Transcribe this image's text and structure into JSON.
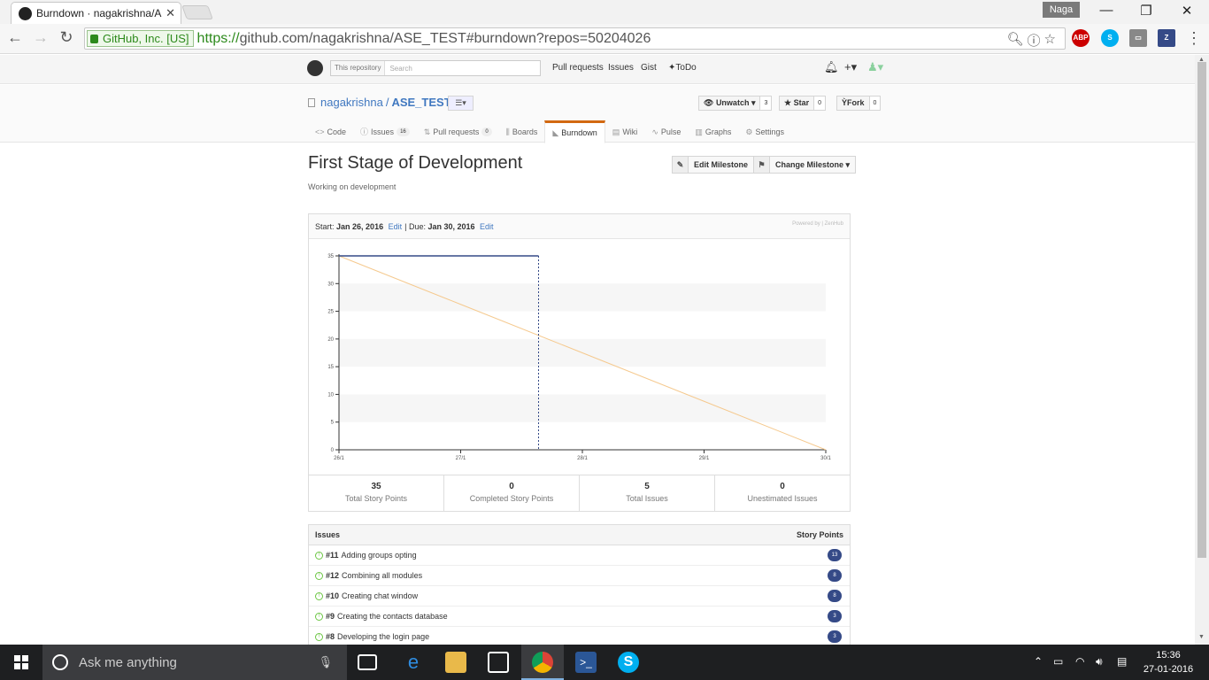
{
  "browser": {
    "tab_title": "Burndown · nagakrishna/A",
    "profile": "Naga",
    "ev_cert": "GitHub, Inc. [US]",
    "url_scheme": "https://",
    "url_rest": "github.com/nagakrishna/ASE_TEST#burndown?repos=50204026"
  },
  "github_header": {
    "search_scope": "This repository",
    "search_placeholder": "Search",
    "nav": [
      "Pull requests",
      "Issues",
      "Gist",
      "ToDo"
    ]
  },
  "repo": {
    "owner": "nagakrishna",
    "name": "ASE_TEST",
    "unwatch_label": "Unwatch",
    "unwatch_count": "3",
    "star_label": "Star",
    "star_count": "0",
    "fork_label": "Fork",
    "fork_count": "0",
    "tabs": [
      {
        "label": "Code",
        "icon": "<>"
      },
      {
        "label": "Issues",
        "counter": "16"
      },
      {
        "label": "Pull requests",
        "counter": "0"
      },
      {
        "label": "Boards"
      },
      {
        "label": "Burndown"
      },
      {
        "label": "Wiki"
      },
      {
        "label": "Pulse"
      },
      {
        "label": "Graphs"
      },
      {
        "label": "Settings"
      }
    ]
  },
  "milestone": {
    "title": "First Stage of Development",
    "description": "Working on development",
    "edit_label": "Edit Milestone",
    "change_label": "Change Milestone",
    "start_label": "Start:",
    "start_date": "Jan 26, 2016",
    "due_label": "Due:",
    "due_date": "Jan 30, 2016",
    "edit_link": "Edit",
    "powered_by": "Powered by | ZenHub"
  },
  "chart_data": {
    "type": "line",
    "x": [
      "26/1",
      "27/1",
      "28/1",
      "29/1",
      "30/1"
    ],
    "yticks": [
      0,
      5,
      10,
      15,
      20,
      25,
      30,
      35
    ],
    "ylim": [
      0,
      35
    ],
    "series": [
      {
        "values": [
          35,
          35,
          35
        ],
        "color": "#354a87"
      },
      {
        "values": [
          35,
          26.25,
          17.5,
          8.75,
          0
        ],
        "color": "#f5c98e"
      }
    ],
    "grid": true
  },
  "stats": [
    {
      "value": "35",
      "label": "Total Story Points"
    },
    {
      "value": "0",
      "label": "Completed Story Points"
    },
    {
      "value": "5",
      "label": "Total Issues"
    },
    {
      "value": "0",
      "label": "Unestimated Issues"
    }
  ],
  "issues": {
    "header_left": "Issues",
    "header_right": "Story Points",
    "rows": [
      {
        "number": "#11",
        "title": "Adding groups opting",
        "points": "13"
      },
      {
        "number": "#12",
        "title": "Combining all modules",
        "points": "8"
      },
      {
        "number": "#10",
        "title": "Creating chat window",
        "points": "8"
      },
      {
        "number": "#9",
        "title": "Creating the contacts database",
        "points": "3"
      },
      {
        "number": "#8",
        "title": "Developing the login page",
        "points": "3"
      }
    ]
  },
  "taskbar": {
    "search_placeholder": "Ask me anything",
    "time": "15:36",
    "date": "27-01-2016"
  }
}
